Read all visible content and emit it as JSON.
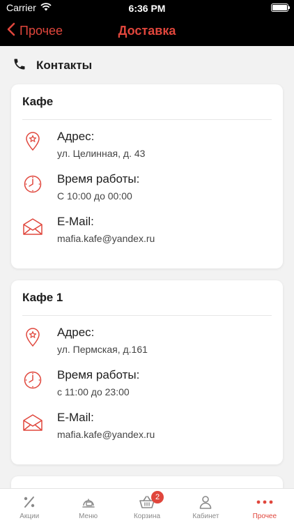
{
  "status_bar": {
    "carrier": "Carrier",
    "time": "6:36 PM"
  },
  "nav": {
    "back_label": "Прочее",
    "title": "Доставка"
  },
  "section": {
    "title": "Контакты"
  },
  "cards": [
    {
      "title": "Кафе",
      "address_label": "Адрес:",
      "address": "ул. Целинная, д. 43",
      "hours_label": "Время работы:",
      "hours": "С 10:00 до 00:00",
      "email_label": "E-Mail:",
      "email": "mafia.kafe@yandex.ru"
    },
    {
      "title": "Кафе 1",
      "address_label": "Адрес:",
      "address": "ул. Пермская, д.161",
      "hours_label": "Время работы:",
      "hours": "с 11:00 до 23:00",
      "email_label": "E-Mail:",
      "email": "mafia.kafe@yandex.ru"
    }
  ],
  "tabbar": {
    "items": [
      {
        "label": "Акции",
        "icon": "percent-icon"
      },
      {
        "label": "Меню",
        "icon": "menu-food-icon"
      },
      {
        "label": "Корзина",
        "icon": "basket-icon",
        "badge": "2"
      },
      {
        "label": "Кабинет",
        "icon": "user-icon"
      },
      {
        "label": "Прочее",
        "icon": "more-dots-icon",
        "active": true
      }
    ]
  },
  "colors": {
    "accent": "#e0463c",
    "header_bg": "#000000",
    "page_bg": "#f2f2f2",
    "inactive_tab": "#8a8a8a"
  }
}
